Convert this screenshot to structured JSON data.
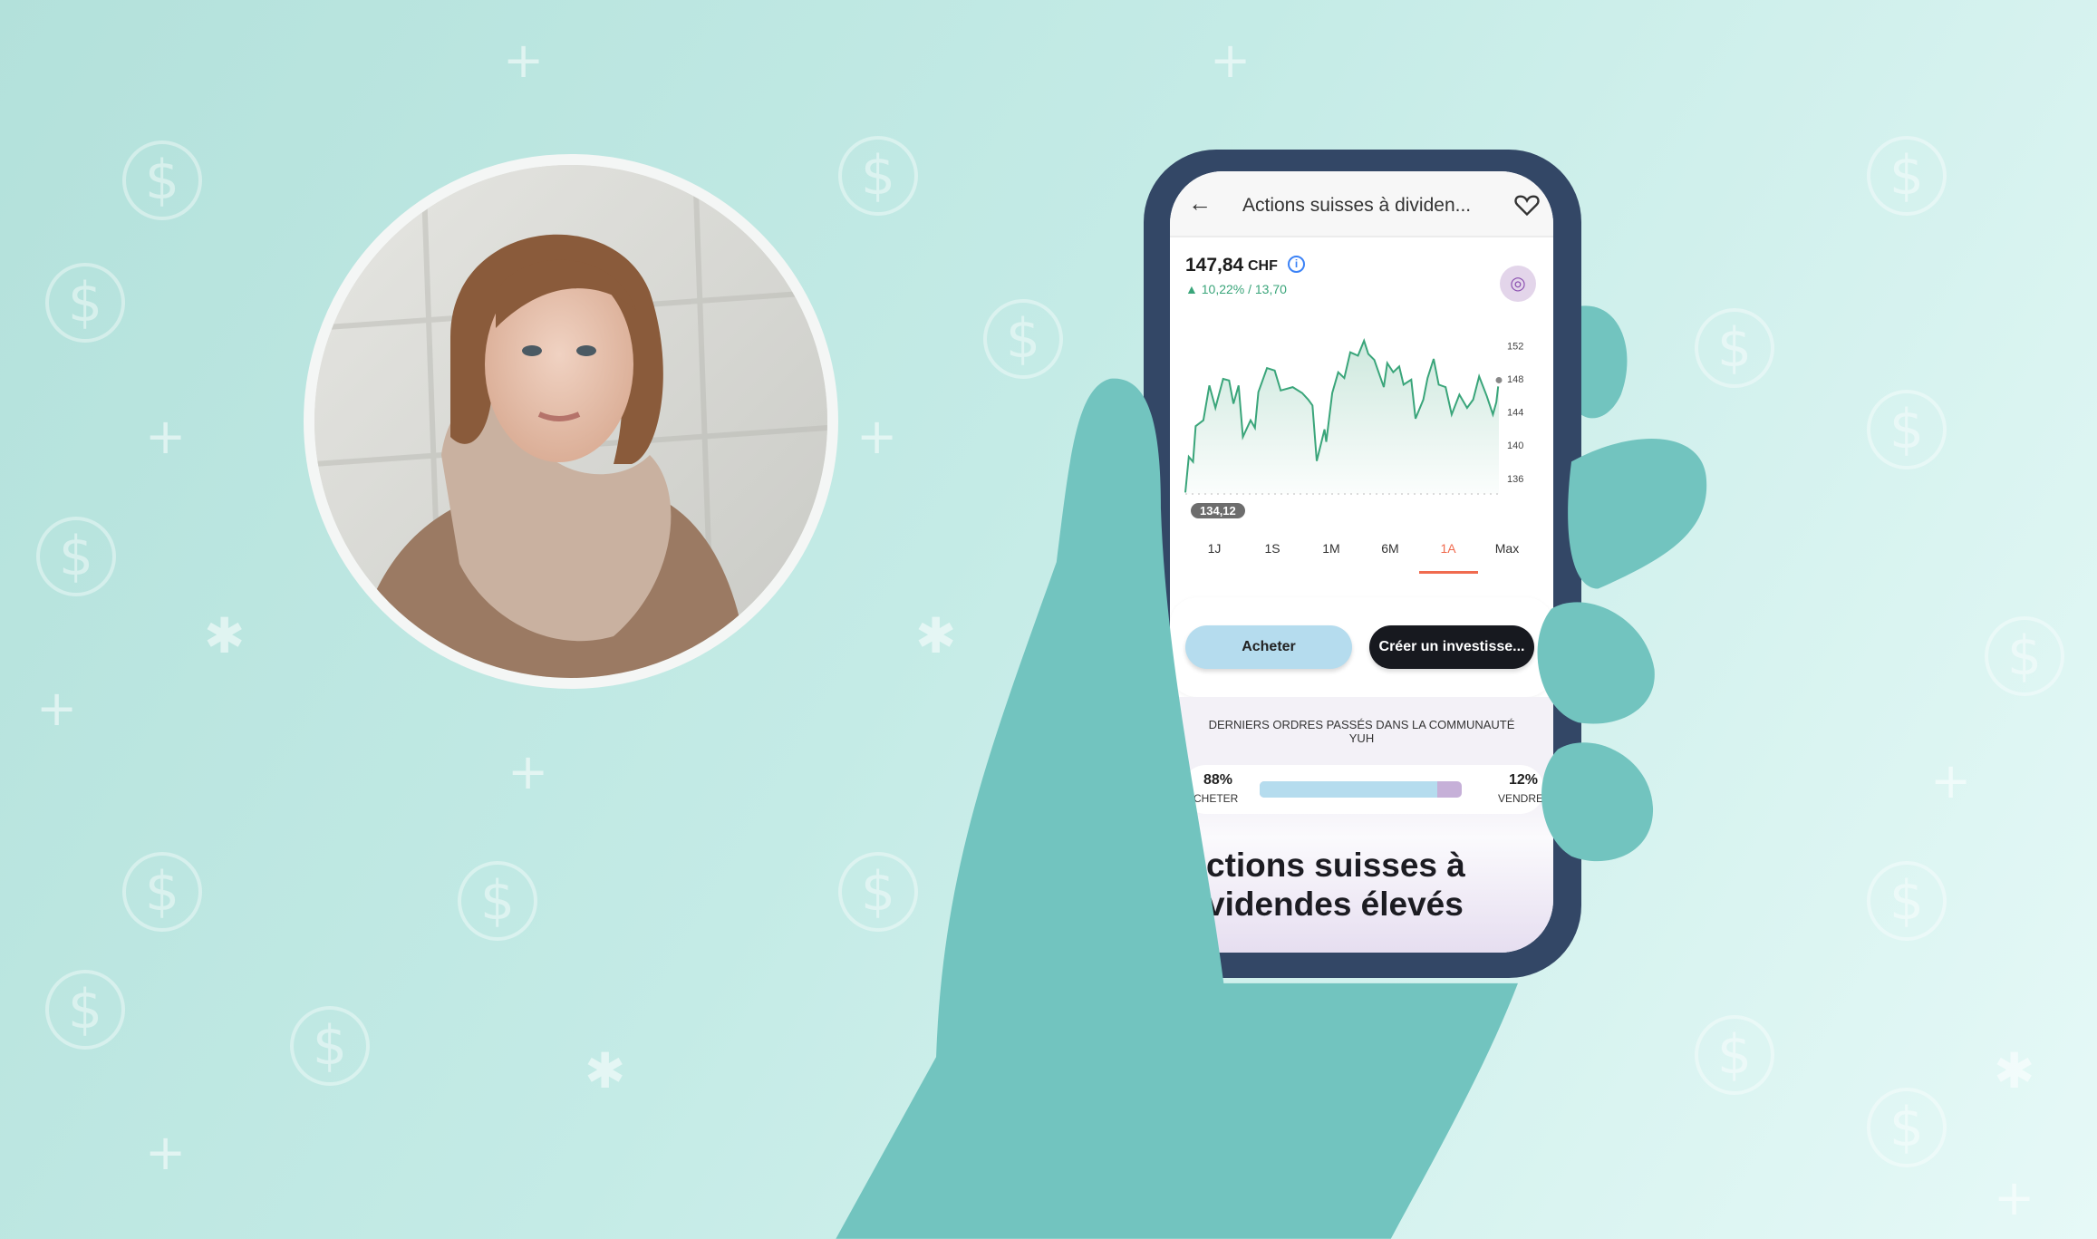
{
  "header": {
    "title": "Actions suisses à dividen...",
    "back_icon": "arrow-left-icon",
    "favorite_icon": "heart-icon"
  },
  "price": {
    "value": "147,84",
    "currency": "CHF",
    "change": "▲ 10,22% / 13,70",
    "info_icon": "info-icon"
  },
  "chart_data": {
    "type": "area",
    "title": "",
    "xlabel": "",
    "ylabel": "",
    "ylim": [
      134.12,
      153
    ],
    "y_ticks": [
      "152",
      "148",
      "144",
      "140",
      "136"
    ],
    "baseline_label": "134,12",
    "x": [
      0,
      4,
      9,
      12,
      21,
      28,
      35,
      44,
      51,
      56,
      62,
      67,
      76,
      81,
      85,
      95,
      104,
      111,
      125,
      136,
      143,
      148,
      153,
      162,
      164,
      171,
      178,
      185,
      192,
      201,
      208,
      213,
      220,
      231,
      235,
      242,
      249,
      254,
      263,
      268,
      277,
      282,
      289,
      295,
      303,
      310,
      319,
      328,
      335,
      342,
      351,
      358,
      362,
      365
    ],
    "values": [
      134.3,
      138.6,
      138.0,
      142.3,
      143.0,
      147.2,
      144.5,
      148.0,
      147.8,
      145.0,
      147.2,
      141.0,
      143.0,
      142.1,
      146.4,
      149.3,
      149.0,
      146.6,
      147.0,
      146.3,
      145.5,
      144.8,
      138.1,
      141.9,
      140.4,
      146.3,
      148.8,
      148.1,
      151.2,
      150.8,
      152.6,
      151.0,
      150.3,
      147.0,
      149.9,
      148.8,
      149.5,
      147.3,
      147.9,
      143.2,
      145.5,
      148.1,
      150.4,
      147.3,
      147.0,
      143.7,
      146.1,
      144.5,
      145.5,
      148.3,
      145.9,
      143.7,
      145.2,
      147.84
    ],
    "line_color": "#3aa57a"
  },
  "periods": {
    "items": [
      "1J",
      "1S",
      "1M",
      "6M",
      "1A",
      "Max"
    ],
    "active": "1A",
    "accent": "#f06b4f"
  },
  "actions": {
    "buy": "Acheter",
    "invest": "Créer un investisse..."
  },
  "community": {
    "title_line1": "DERNIERS ORDRES PASSÉS DANS LA COMMUNAUTÉ",
    "title_line2": "YUH",
    "buy_pct": "88%",
    "buy_label": "ACHETER",
    "sell_pct": "12%",
    "sell_label": "VENDRE",
    "buy_fraction": 0.88
  },
  "product": {
    "title_line1": "ctions suisses à",
    "title_line2": "videndes élevés"
  }
}
